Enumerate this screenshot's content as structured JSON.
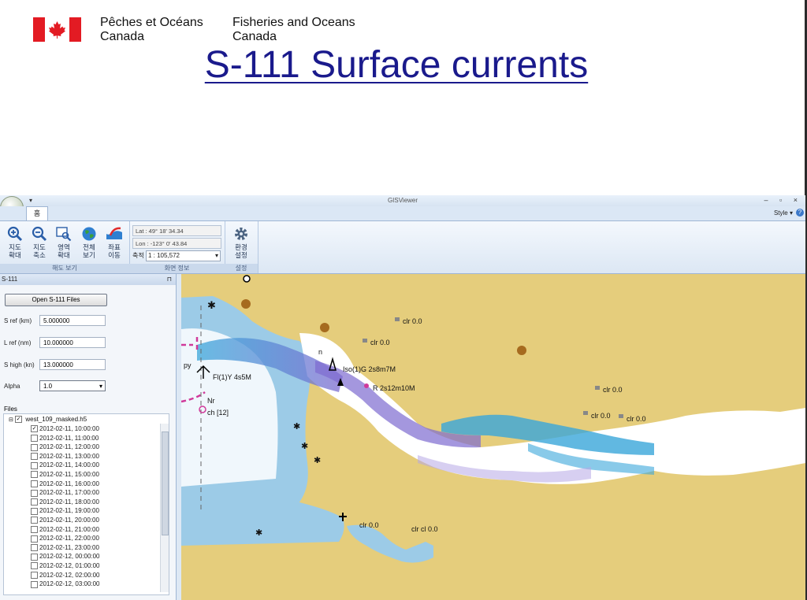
{
  "header": {
    "org_fr_line1": "Pêches et Océans",
    "org_fr_line2": "Canada",
    "org_en_line1": "Fisheries and Oceans",
    "org_en_line2": "Canada",
    "title": "S-111 Surface currents",
    "flag_color": "#e31b23"
  },
  "app": {
    "window_title": "GISViewer",
    "qat_glyph": "▾",
    "tab_home": "홈",
    "style_menu": "Style  ▾",
    "help_glyph": "?",
    "window_controls": "– ▫ ×",
    "ribbon": {
      "group1_label": "해도 보기",
      "group2_label": "화면 정보",
      "group3_label": "설정",
      "btn_zoom_in": [
        "지도",
        "확대"
      ],
      "btn_zoom_out": [
        "지도",
        "축소"
      ],
      "btn_area_zoom": [
        "영역",
        "확대"
      ],
      "btn_full_view": [
        "전체",
        "보기"
      ],
      "btn_move": [
        "좌표",
        "이동"
      ],
      "btn_settings": [
        "환경",
        "설정"
      ],
      "lat": "Lat : 49° 18' 34.34",
      "lon": "Lon : -123° 0' 43.84",
      "scale_label": "축적",
      "scale_value": "1 : 105,572"
    },
    "panel": {
      "title": "S-111",
      "pin_glyph": "⊓",
      "open_button": "Open S-111 Files",
      "s_ref_label": "S ref (km)",
      "s_ref_value": "5.000000",
      "l_ref_label": "L ref (nm)",
      "l_ref_value": "10.000000",
      "s_high_label": "S high (kn)",
      "s_high_value": "13.000000",
      "alpha_label": "Alpha",
      "alpha_value": "1.0",
      "files_label": "Files",
      "root_file": "west_109_masked.h5",
      "entries": [
        "2012-02-11, 10:00:00",
        "2012-02-11, 11:00:00",
        "2012-02-11, 12:00:00",
        "2012-02-11, 13:00:00",
        "2012-02-11, 14:00:00",
        "2012-02-11, 15:00:00",
        "2012-02-11, 16:00:00",
        "2012-02-11, 17:00:00",
        "2012-02-11, 18:00:00",
        "2012-02-11, 19:00:00",
        "2012-02-11, 20:00:00",
        "2012-02-11, 21:00:00",
        "2012-02-11, 22:00:00",
        "2012-02-11, 23:00:00",
        "2012-02-12, 00:00:00",
        "2012-02-12, 01:00:00",
        "2012-02-12, 02:00:00",
        "2012-02-12, 03:00:00"
      ],
      "checked_index": 0
    },
    "map_labels": {
      "clr1": "clr  0.0",
      "clr2": "clr  0.0",
      "clr3": "clr  0.0",
      "clr4": "clr  0.0",
      "clr5": "clr  0.0",
      "clr6": "clr  0.0",
      "clr7": "clr  0.0",
      "clr8": "clr cl  0.0",
      "light1": "Iso(1)G 2s8m7M",
      "light2": "R 2s12m10M",
      "light3": "Fl(1)Y 4s5M",
      "nr": "Nr",
      "ch": "ch [12]",
      "py": "py",
      "n_mark": "n"
    }
  }
}
